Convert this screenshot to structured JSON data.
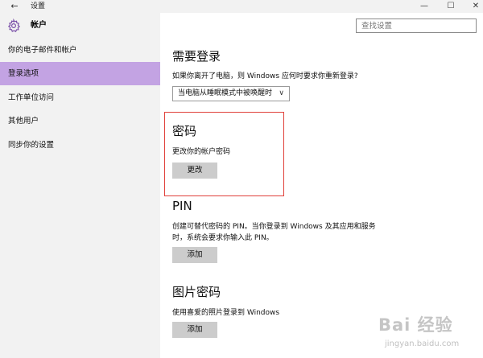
{
  "window": {
    "back_glyph": "←",
    "title": "设置",
    "min_glyph": "—",
    "max_glyph": "☐",
    "close_glyph": "✕"
  },
  "sidebar": {
    "header": {
      "icon": "gear-icon",
      "title": "帐户"
    },
    "items": [
      {
        "label": "你的电子邮件和帐户",
        "active": false
      },
      {
        "label": "登录选项",
        "active": true
      },
      {
        "label": "工作单位访问",
        "active": false
      },
      {
        "label": "其他用户",
        "active": false
      },
      {
        "label": "同步你的设置",
        "active": false
      }
    ]
  },
  "search": {
    "placeholder": "查找设置"
  },
  "sections": {
    "signin": {
      "title": "需要登录",
      "description": "如果你离开了电脑，则 Windows 应何时要求你重新登录?",
      "dropdown_value": "当电脑从睡眠模式中被唤醒时"
    },
    "password": {
      "title": "密码",
      "description": "更改你的帐户密码",
      "button": "更改"
    },
    "pin": {
      "title": "PIN",
      "description_line1": "创建可替代密码的 PIN。当你登录到 Windows 及其应用和服务",
      "description_line2": "时，系统会要求你输入此 PIN。",
      "button": "添加"
    },
    "picture_password": {
      "title": "图片密码",
      "description": "使用喜爱的照片登录到 Windows",
      "button": "添加"
    }
  },
  "watermark": {
    "logo": "Bai 经验",
    "url": "jingyan.baidu.com"
  },
  "colors": {
    "accent": "#c3a3e3",
    "highlight_border": "#e0403a",
    "sidebar_bg": "#f2f2f2",
    "button_bg": "#cccccc"
  }
}
